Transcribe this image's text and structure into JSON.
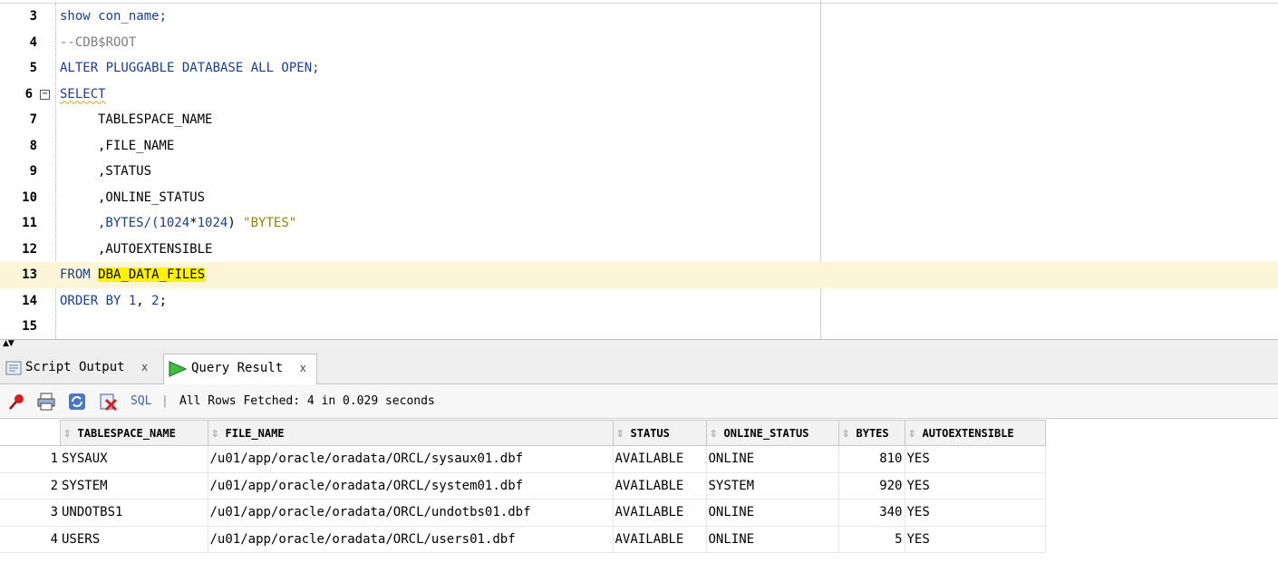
{
  "editor": {
    "lines": [
      {
        "num": "3",
        "text": "show con_name;"
      },
      {
        "num": "4",
        "text": "--CDB$ROOT"
      },
      {
        "num": "5",
        "text": "ALTER PLUGGABLE DATABASE ALL OPEN;"
      },
      {
        "num": "6",
        "text": "SELECT"
      },
      {
        "num": "7",
        "text": "TABLESPACE_NAME"
      },
      {
        "num": "8",
        "text": ",FILE_NAME"
      },
      {
        "num": "9",
        "text": ",STATUS"
      },
      {
        "num": "10",
        "text": ",ONLINE_STATUS"
      },
      {
        "num": "11",
        "text_a": ",BYTES/(",
        "text_b": "1024",
        "text_c": "*",
        "text_d": "1024",
        "text_e": ") ",
        "text_f": "\"BYTES\""
      },
      {
        "num": "12",
        "text": ",AUTOEXTENSIBLE"
      },
      {
        "num": "13",
        "text_a": "FROM ",
        "text_b": "DBA_DATA_FILES"
      },
      {
        "num": "14",
        "text_a": "ORDER BY ",
        "text_b": "1",
        "text_c": ", ",
        "text_d": "2",
        "text_e": ";"
      },
      {
        "num": "15",
        "text": ""
      }
    ],
    "fold_symbol": "−"
  },
  "tabs": [
    {
      "label": "Script Output",
      "close": "x",
      "icon": "script-output-icon"
    },
    {
      "label": "Query Result",
      "close": "x",
      "icon": "run-arrow-icon"
    }
  ],
  "toolbar": {
    "sql_label": "SQL",
    "separator": "|",
    "status": "All Rows Fetched: 4 in 0.029 seconds"
  },
  "grid": {
    "columns": [
      "TABLESPACE_NAME",
      "FILE_NAME",
      "STATUS",
      "ONLINE_STATUS",
      "BYTES",
      "AUTOEXTENSIBLE"
    ],
    "rows": [
      {
        "n": "1",
        "tablespace": "SYSAUX",
        "file": "/u01/app/oracle/oradata/ORCL/sysaux01.dbf",
        "status": "AVAILABLE",
        "online": "ONLINE",
        "bytes": "810",
        "auto": "YES"
      },
      {
        "n": "2",
        "tablespace": "SYSTEM",
        "file": "/u01/app/oracle/oradata/ORCL/system01.dbf",
        "status": "AVAILABLE",
        "online": "SYSTEM",
        "bytes": "920",
        "auto": "YES"
      },
      {
        "n": "3",
        "tablespace": "UNDOTBS1",
        "file": "/u01/app/oracle/oradata/ORCL/undotbs01.dbf",
        "status": "AVAILABLE",
        "online": "ONLINE",
        "bytes": "340",
        "auto": "YES"
      },
      {
        "n": "4",
        "tablespace": "USERS",
        "file": "/u01/app/oracle/oradata/ORCL/users01.dbf",
        "status": "AVAILABLE",
        "online": "ONLINE",
        "bytes": "5",
        "auto": "YES"
      }
    ]
  },
  "colors": {
    "keyword": "#1a3d8f",
    "comment": "#808080",
    "string": "#8a8a00",
    "highlight": "#fff200",
    "current_line": "#fdf5d8"
  }
}
